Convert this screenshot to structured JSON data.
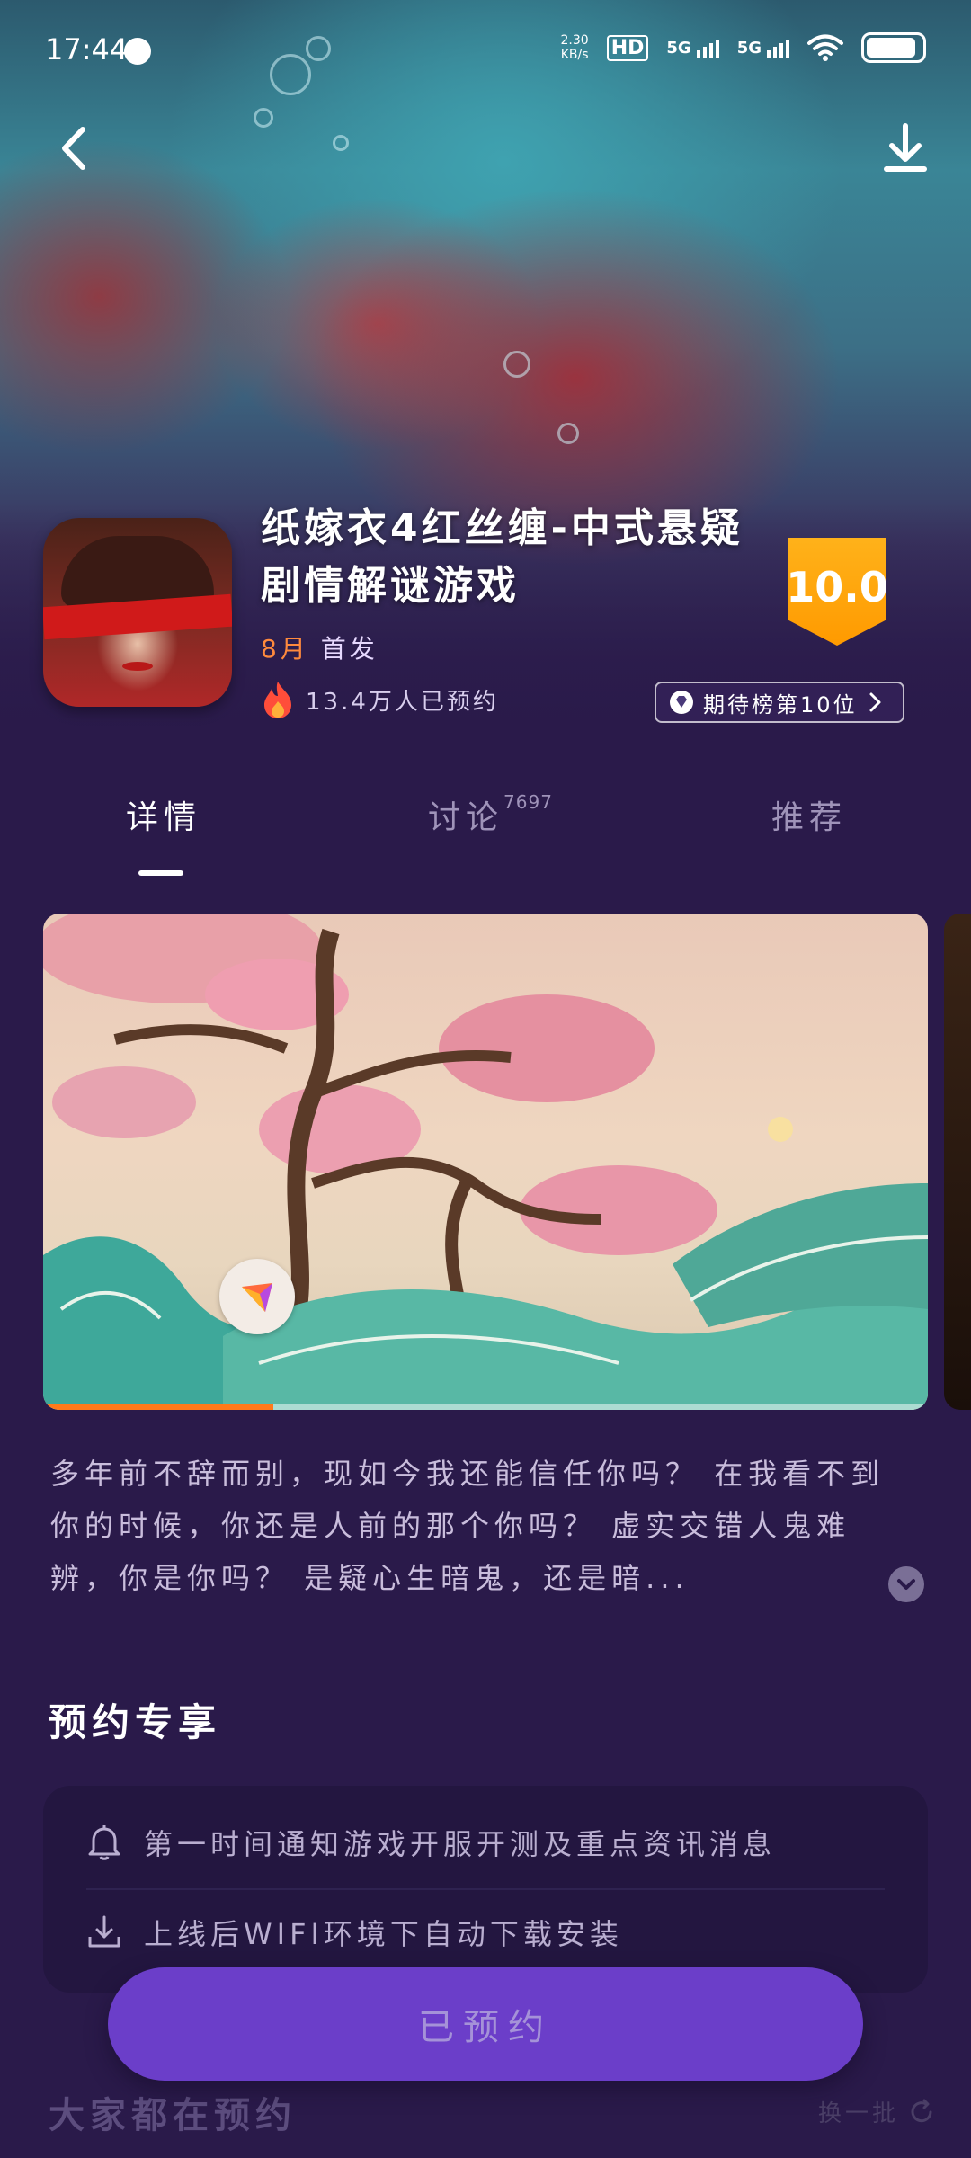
{
  "status_bar": {
    "time": "17:44",
    "net_speed_value": "2.30",
    "net_speed_unit": "KB/s",
    "hd_label": "HD",
    "signal1_label": "5G",
    "signal2_label": "5G"
  },
  "game": {
    "title": "纸嫁衣4红丝缠-中式悬疑剧情解谜游戏",
    "release_month": "8月",
    "release_suffix": "首发",
    "reservation_count": "13.4万人已预约",
    "score": "10.0",
    "rank_label": "期待榜第10位"
  },
  "tabs": [
    {
      "label": "详情",
      "count": ""
    },
    {
      "label": "讨论",
      "count": "7697"
    },
    {
      "label": "推荐",
      "count": ""
    }
  ],
  "media": {
    "progress": 0.26
  },
  "description": "多年前不辞而别，现如今我还能信任你吗？ 在我看不到你的时候，你还是人前的那个你吗？ 虚实交错人鬼难辨，你是你吗？ 是疑心生暗鬼，还是暗...",
  "perks": {
    "title": "预约专享",
    "items": [
      {
        "icon": "bell-icon",
        "text": "第一时间通知游戏开服开测及重点资讯消息"
      },
      {
        "icon": "download-icon",
        "text": "上线后WIFI环境下自动下载安装"
      }
    ]
  },
  "cta_label": "已预约",
  "more": {
    "title": "大家都在预约",
    "refresh_label": "换一批"
  },
  "colors": {
    "background": "#2a1a4a",
    "accent_orange": "#ff8a3d",
    "score_badge": "#ff9a00",
    "cta_purple": "#6b3ec9"
  }
}
